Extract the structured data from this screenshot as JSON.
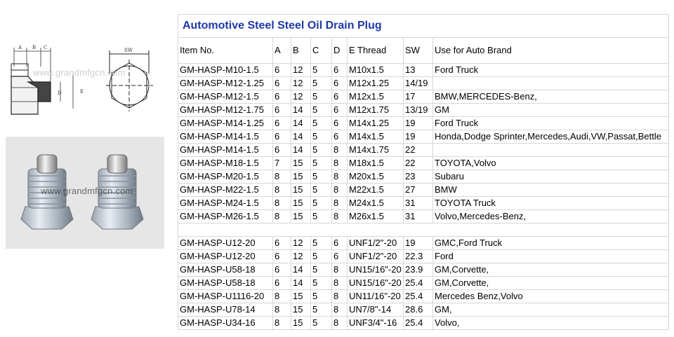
{
  "title": "Automotive Steel Steel Oil Drain Plug",
  "drawing": {
    "labels": {
      "a": "A",
      "b": "B",
      "c": "C",
      "d": "D",
      "e": "E",
      "sw": "SW"
    }
  },
  "watermark": "www.grandmfgcn.com",
  "watermark_photo": "www.grandmfgcn.com",
  "headers": [
    "Item No.",
    "A",
    "B",
    "C",
    "D",
    "E Thread",
    "SW",
    "Use for Auto Brand"
  ],
  "metric_rows": [
    [
      "GM-HASP-M10-1.5",
      "6",
      "12",
      "5",
      "6",
      "M10x1.5",
      "13",
      "Ford Truck"
    ],
    [
      "GM-HASP-M12-1.25",
      "6",
      "12",
      "5",
      "6",
      "M12x1.25",
      "14/19",
      ""
    ],
    [
      "GM-HASP-M12-1.5",
      "6",
      "12",
      "5",
      "6",
      "M12x1.5",
      "17",
      "BMW,MERCEDES-Benz,"
    ],
    [
      "GM-HASP-M12-1.75",
      "6",
      "14",
      "5",
      "6",
      "M12x1.75",
      "13/19",
      "GM"
    ],
    [
      "GM-HASP-M14-1.25",
      "6",
      "14",
      "5",
      "6",
      "M14x1.25",
      "19",
      "Ford Truck"
    ],
    [
      "GM-HASP-M14-1.5",
      "6",
      "14",
      "5",
      "6",
      "M14x1.5",
      "19",
      "Honda,Dodge Sprinter,Mercedes,Audi,VW,Passat,Bettle"
    ],
    [
      "GM-HASP-M14-1.5",
      "6",
      "14",
      "5",
      "8",
      "M14x1.75",
      "22",
      ""
    ],
    [
      "GM-HASP-M18-1.5",
      "7",
      "15",
      "5",
      "8",
      "M18x1.5",
      "22",
      "TOYOTA,Volvo"
    ],
    [
      "GM-HASP-M20-1.5",
      "8",
      "15",
      "5",
      "8",
      "M20x1.5",
      "23",
      "Subaru"
    ],
    [
      "GM-HASP-M22-1.5",
      "8",
      "15",
      "5",
      "8",
      "M22x1.5",
      "27",
      "BMW"
    ],
    [
      "GM-HASP-M24-1.5",
      "8",
      "15",
      "5",
      "8",
      "M24x1.5",
      "31",
      "TOYOTA Truck"
    ],
    [
      "GM-HASP-M26-1.5",
      "8",
      "15",
      "5",
      "8",
      "M26x1.5",
      "31",
      "Volvo,Mercedes-Benz,"
    ]
  ],
  "unf_rows": [
    [
      "GM-HASP-U12-20",
      "6",
      "12",
      "5",
      "6",
      "UNF1/2\"-20",
      "19",
      "GMC,Ford Truck"
    ],
    [
      "GM-HASP-U12-20",
      "6",
      "12",
      "5",
      "6",
      "UNF1/2\"-20",
      "22.3",
      "Ford"
    ],
    [
      "GM-HASP-U58-18",
      "6",
      "14",
      "5",
      "8",
      "UN15/16\"-20",
      "23.9",
      "GM,Corvette,"
    ],
    [
      "GM-HASP-U58-18",
      "6",
      "14",
      "5",
      "8",
      "UN15/16\"-20",
      "25.4",
      "GM,Corvette,"
    ],
    [
      "GM-HASP-U1116-20",
      "8",
      "15",
      "5",
      "8",
      "UN11/16\"-20",
      "25.4",
      "Mercedes Benz,Volvo"
    ],
    [
      "GM-HASP-U78-14",
      "8",
      "15",
      "5",
      "8",
      "UN7/8\"-14",
      "28.6",
      "GM,"
    ],
    [
      "GM-HASP-U34-16",
      "8",
      "15",
      "5",
      "8",
      "UNF3/4\"-16",
      "25.4",
      "Volvo,"
    ]
  ]
}
